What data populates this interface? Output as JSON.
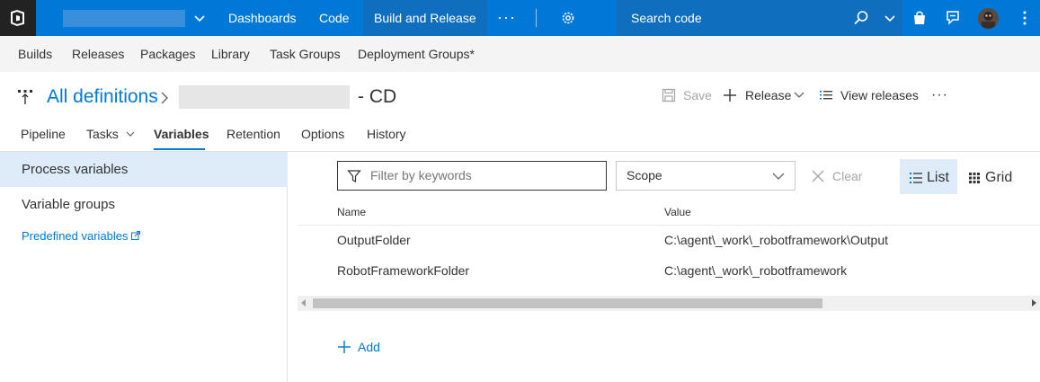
{
  "topbar": {
    "nav": [
      "Dashboards",
      "Code",
      "Build and Release"
    ],
    "active_nav": "Build and Release",
    "more": "···",
    "search_placeholder": "Search code",
    "accent": "#0078d7"
  },
  "subnav": {
    "items": [
      "Builds",
      "Releases",
      "Packages",
      "Library",
      "Task Groups",
      "Deployment Groups*"
    ]
  },
  "header": {
    "breadcrumb": "All definitions",
    "title_suffix": "- CD",
    "save_label": "Save",
    "release_label": "Release",
    "view_releases_label": "View releases",
    "more": "···"
  },
  "tabs": {
    "items": [
      "Pipeline",
      "Tasks",
      "Variables",
      "Retention",
      "Options",
      "History"
    ],
    "active": "Variables"
  },
  "sidebar": {
    "items": [
      "Process variables",
      "Variable groups"
    ],
    "selected": "Process variables",
    "link": "Predefined variables"
  },
  "toolbar": {
    "filter_placeholder": "Filter by keywords",
    "scope_value": "Scope",
    "clear_label": "Clear",
    "list_label": "List",
    "grid_label": "Grid"
  },
  "table": {
    "columns": [
      "Name",
      "Value"
    ],
    "rows": [
      [
        "OutputFolder",
        "C:\\agent\\_work\\_robotframework\\Output"
      ],
      [
        "RobotFrameworkFolder",
        "C:\\agent\\_work\\_robotframework"
      ]
    ]
  },
  "actions": {
    "add_label": "Add"
  }
}
